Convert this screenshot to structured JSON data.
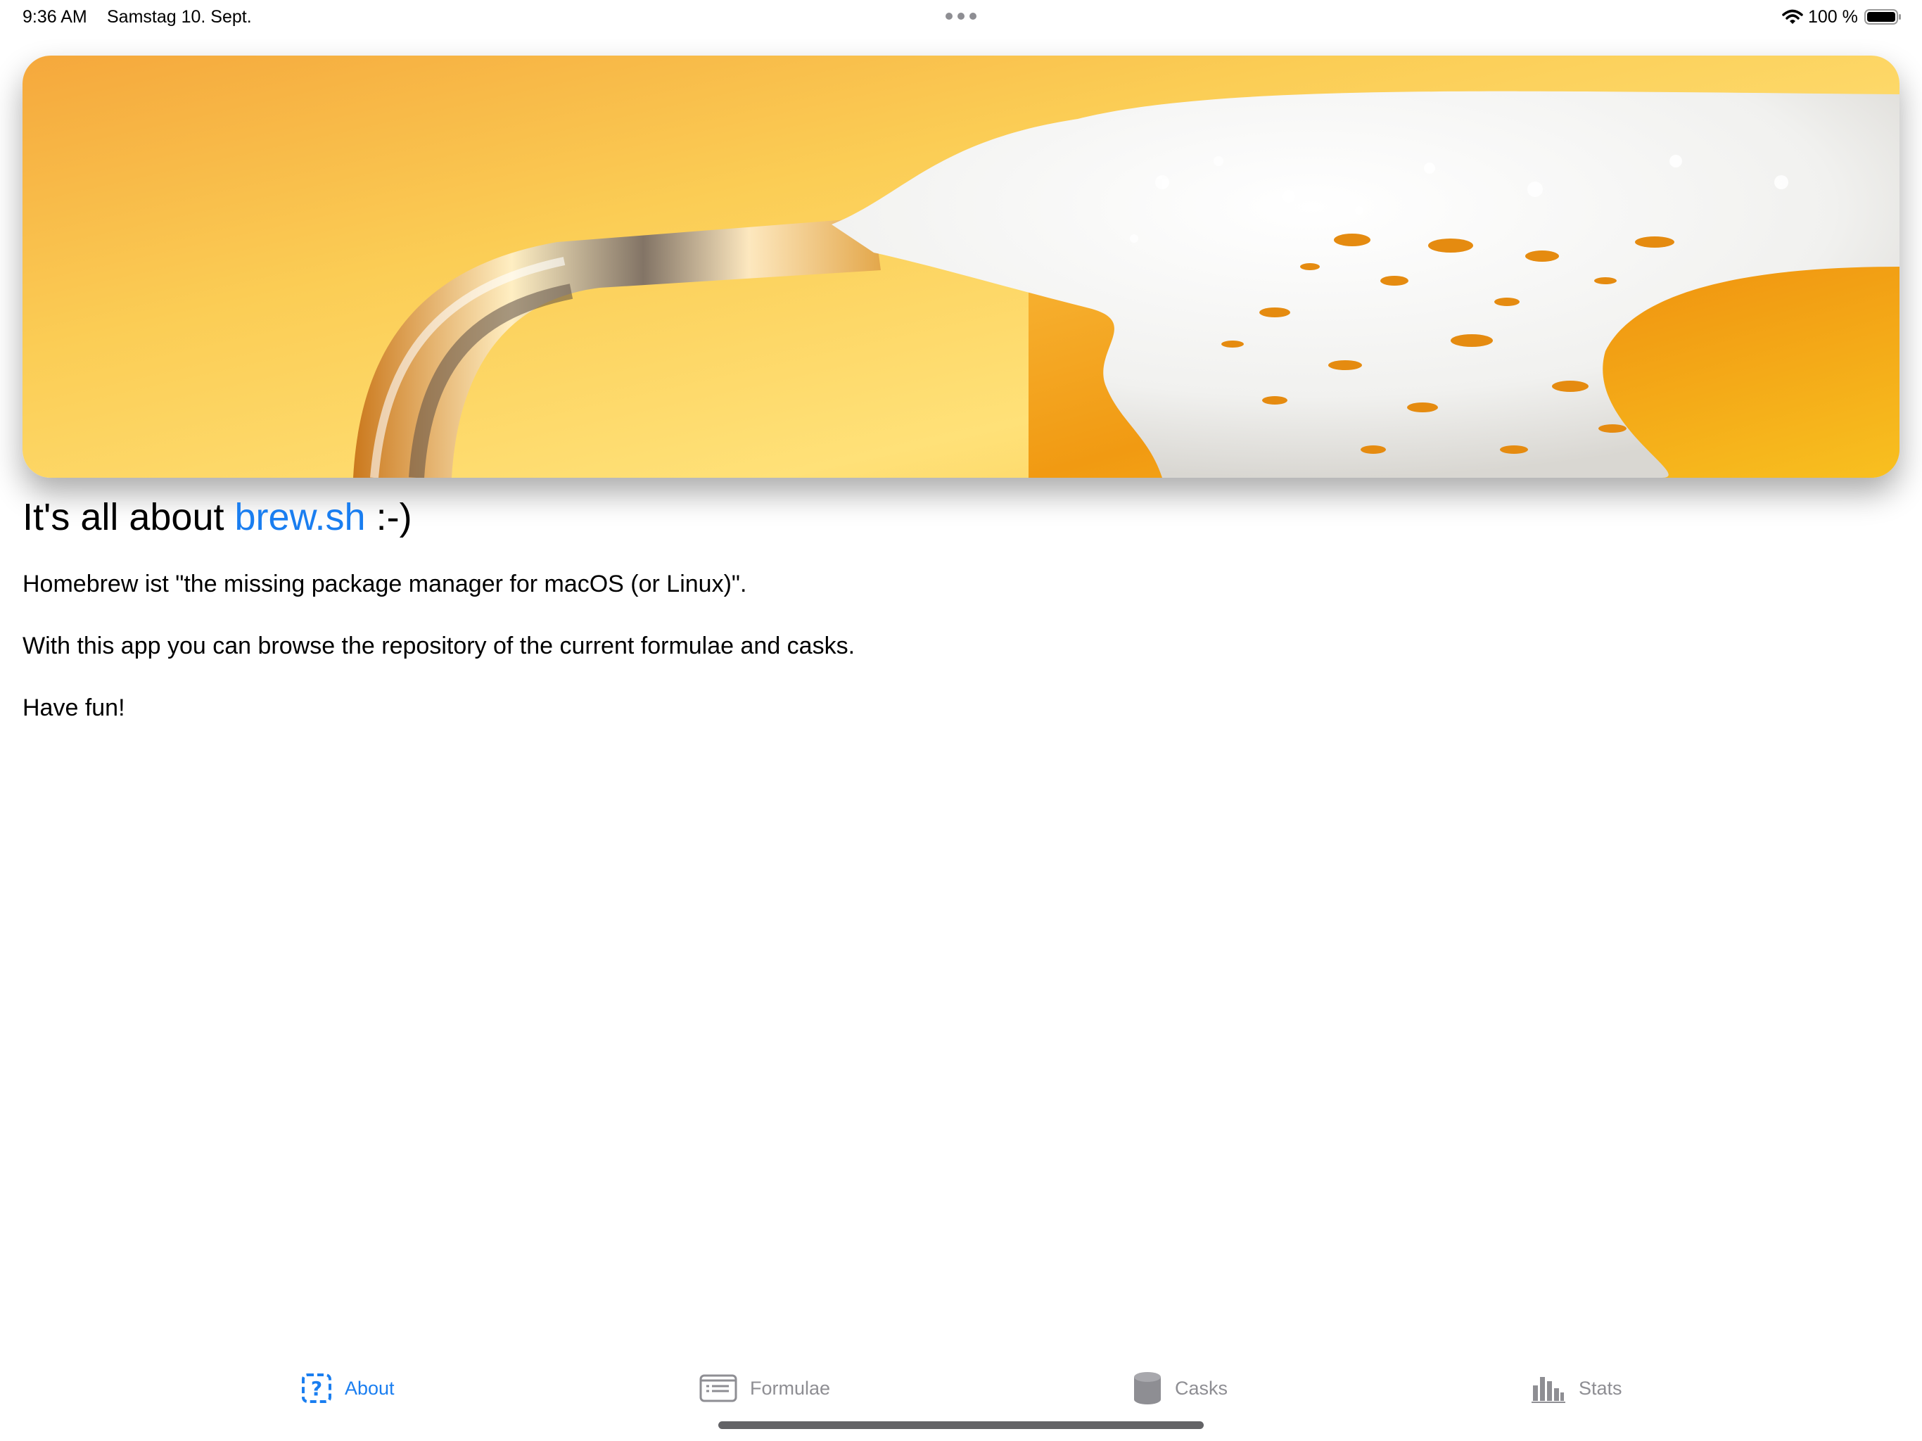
{
  "status_bar": {
    "time": "9:36 AM",
    "date": "Samstag 10. Sept.",
    "battery_percent": "100 %",
    "wifi_icon": "wifi-icon",
    "battery_icon": "battery-full-icon"
  },
  "hero": {
    "image_name": "beer-mug-photo"
  },
  "about": {
    "headline_prefix": "It's all about ",
    "headline_link": "brew.sh",
    "headline_suffix": " :-)",
    "paragraphs": [
      "Homebrew ist \"the missing package manager for macOS (or Linux)\".",
      "With this app you can browse the repository of the current formulae and casks.",
      "Have fun!"
    ]
  },
  "colors": {
    "accent": "#1a7ef0",
    "inactive": "#8e8e93"
  },
  "tab_bar": {
    "selected": "About",
    "tabs": [
      {
        "label": "About",
        "icon": "questionmark-dashed-square-icon"
      },
      {
        "label": "Formulae",
        "icon": "list-window-icon"
      },
      {
        "label": "Casks",
        "icon": "cylinder-icon"
      },
      {
        "label": "Stats",
        "icon": "bar-chart-icon"
      }
    ]
  }
}
